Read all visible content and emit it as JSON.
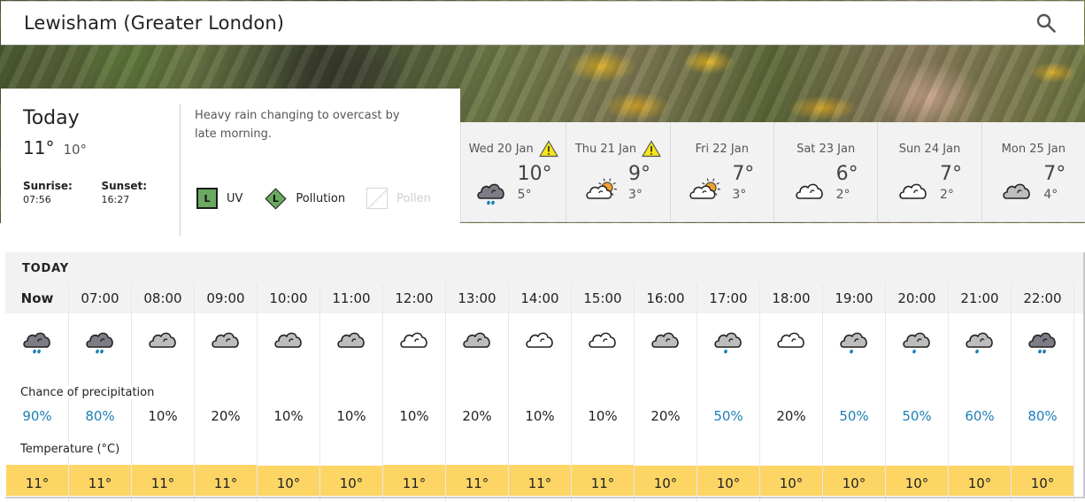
{
  "header": {
    "location": "Lewisham (Greater London)",
    "search_icon": "search-icon"
  },
  "today": {
    "title": "Today",
    "high": "11°",
    "low": "10°",
    "sunrise_label": "Sunrise:",
    "sunrise": "07:56",
    "sunset_label": "Sunset:",
    "sunset": "16:27",
    "summary": "Heavy rain changing to overcast by late morning.",
    "indices": {
      "uv": {
        "level": "L",
        "label": "UV",
        "color": "#6ba961"
      },
      "pollution": {
        "level": "L",
        "label": "Pollution",
        "color": "#6ba961"
      },
      "pollen": {
        "level": "",
        "label": "Pollen",
        "available": false
      }
    }
  },
  "days": [
    {
      "label": "Wed 20 Jan",
      "warning": true,
      "icon": "heavy-rain-icon",
      "high": "10°",
      "low": "5°"
    },
    {
      "label": "Thu 21 Jan",
      "warning": true,
      "icon": "sunny-intervals-icon",
      "high": "9°",
      "low": "3°"
    },
    {
      "label": "Fri 22 Jan",
      "warning": false,
      "icon": "sunny-intervals-icon",
      "high": "7°",
      "low": "3°"
    },
    {
      "label": "Sat 23 Jan",
      "warning": false,
      "icon": "white-cloud-icon",
      "high": "6°",
      "low": "2°"
    },
    {
      "label": "Sun 24 Jan",
      "warning": false,
      "icon": "white-cloud-icon",
      "high": "7°",
      "low": "2°"
    },
    {
      "label": "Mon 25 Jan",
      "warning": false,
      "icon": "grey-cloud-icon",
      "high": "7°",
      "low": "4°"
    }
  ],
  "hourly": {
    "section_label": "TODAY",
    "precip_label": "Chance of precipitation",
    "temp_label": "Temperature (°C)",
    "hours": [
      {
        "time": "Now",
        "icon": "heavy-rain",
        "precip": "90%",
        "high_precip": true,
        "temp": "11°"
      },
      {
        "time": "07:00",
        "icon": "heavy-rain",
        "precip": "80%",
        "high_precip": true,
        "temp": "11°"
      },
      {
        "time": "08:00",
        "icon": "grey-cloud",
        "precip": "10%",
        "high_precip": false,
        "temp": "11°"
      },
      {
        "time": "09:00",
        "icon": "grey-cloud",
        "precip": "20%",
        "high_precip": false,
        "temp": "11°"
      },
      {
        "time": "10:00",
        "icon": "grey-cloud",
        "precip": "10%",
        "high_precip": false,
        "temp": "10°"
      },
      {
        "time": "11:00",
        "icon": "grey-cloud",
        "precip": "10%",
        "high_precip": false,
        "temp": "10°"
      },
      {
        "time": "12:00",
        "icon": "white-cloud",
        "precip": "10%",
        "high_precip": false,
        "temp": "11°"
      },
      {
        "time": "13:00",
        "icon": "grey-cloud",
        "precip": "20%",
        "high_precip": false,
        "temp": "11°"
      },
      {
        "time": "14:00",
        "icon": "white-cloud",
        "precip": "10%",
        "high_precip": false,
        "temp": "11°"
      },
      {
        "time": "15:00",
        "icon": "white-cloud",
        "precip": "10%",
        "high_precip": false,
        "temp": "11°"
      },
      {
        "time": "16:00",
        "icon": "grey-cloud",
        "precip": "20%",
        "high_precip": false,
        "temp": "10°"
      },
      {
        "time": "17:00",
        "icon": "light-rain",
        "precip": "50%",
        "high_precip": true,
        "temp": "10°"
      },
      {
        "time": "18:00",
        "icon": "white-cloud",
        "precip": "20%",
        "high_precip": false,
        "temp": "10°"
      },
      {
        "time": "19:00",
        "icon": "light-rain",
        "precip": "50%",
        "high_precip": true,
        "temp": "10°"
      },
      {
        "time": "20:00",
        "icon": "light-rain",
        "precip": "50%",
        "high_precip": true,
        "temp": "10°"
      },
      {
        "time": "21:00",
        "icon": "light-rain",
        "precip": "60%",
        "high_precip": true,
        "temp": "10°"
      },
      {
        "time": "22:00",
        "icon": "heavy-rain",
        "precip": "80%",
        "high_precip": true,
        "temp": "10°"
      }
    ]
  },
  "colors": {
    "rain_drop": "#1d7fb5",
    "precip_high_text": "#1d7fb5",
    "temp_band": "#fcd565",
    "warning_yellow": "#f5e61a",
    "sun_orange": "#f0a030"
  }
}
